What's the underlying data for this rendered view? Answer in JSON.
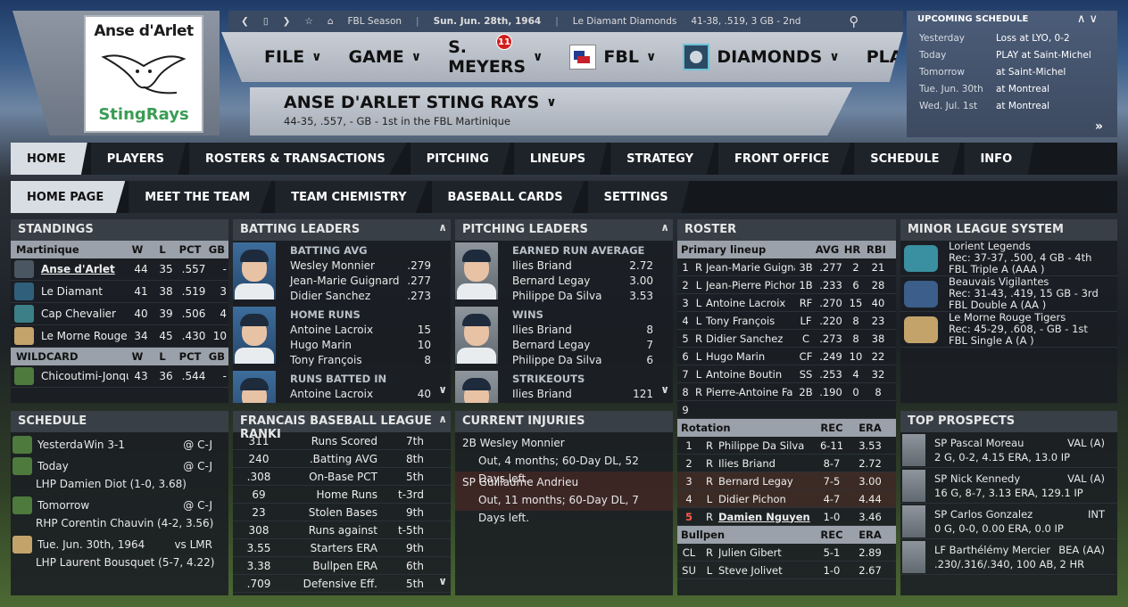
{
  "logo": {
    "line1": "Anse d'Arlet",
    "line2": "StingRays"
  },
  "topbar": {
    "season": "FBL Season",
    "date": "Sun. Jun. 28th, 1964",
    "team": "Le Diamant Diamonds",
    "record": "41-38, .519, 3 GB - 2nd"
  },
  "menu": {
    "file": "FILE",
    "game": "GAME",
    "manager": "S. MEYERS",
    "badge": "11",
    "league": "FBL",
    "team": "DIAMONDS",
    "play": "PLAY"
  },
  "team": {
    "name": "ANSE D'ARLET STING RAYS",
    "summary": "44-35, .557, - GB - 1st in the FBL Martinique"
  },
  "upcoming": {
    "title": "UPCOMING SCHEDULE",
    "rows": [
      {
        "day": "Yesterday",
        "event": "Loss at LYO, 0-2"
      },
      {
        "day": "Today",
        "event": "PLAY at Saint-Michel"
      },
      {
        "day": "Tomorrow",
        "event": "at Saint-Michel"
      },
      {
        "day": "Tue. Jun. 30th",
        "event": "at Montreal"
      },
      {
        "day": "Wed. Jul. 1st",
        "event": "at Montreal"
      }
    ]
  },
  "tabs1": [
    "HOME",
    "PLAYERS",
    "ROSTERS & TRANSACTIONS",
    "PITCHING",
    "LINEUPS",
    "STRATEGY",
    "FRONT OFFICE",
    "SCHEDULE",
    "INFO"
  ],
  "tabs2": [
    "HOME PAGE",
    "MEET THE TEAM",
    "TEAM CHEMISTRY",
    "BASEBALL CARDS",
    "SETTINGS"
  ],
  "standings": {
    "title": "STANDINGS",
    "div": "Martinique",
    "cols": [
      "W",
      "L",
      "PCT",
      "GB"
    ],
    "rows": [
      {
        "team": "Anse d'Arlet",
        "w": "44",
        "l": "35",
        "pct": ".557",
        "gb": "-",
        "color": "#4a5662"
      },
      {
        "team": "Le Diamant",
        "w": "41",
        "l": "38",
        "pct": ".519",
        "gb": "3",
        "color": "#2f5f7a"
      },
      {
        "team": "Cap Chevalier",
        "w": "40",
        "l": "39",
        "pct": ".506",
        "gb": "4",
        "color": "#3c7f86"
      },
      {
        "team": "Le Morne Rouge",
        "w": "34",
        "l": "45",
        "pct": ".430",
        "gb": "10",
        "color": "#c4a36a"
      }
    ],
    "wild": "WILDCARD",
    "wildrows": [
      {
        "team": "Chicoutimi-Jonqu",
        "w": "43",
        "l": "36",
        "pct": ".544",
        "gb": "-",
        "color": "#4e7a3e"
      }
    ]
  },
  "batting": {
    "title": "BATTING LEADERS",
    "groups": [
      {
        "label": "BATTING AVG",
        "rows": [
          [
            "Wesley Monnier",
            ".279"
          ],
          [
            "Jean-Marie Guignard",
            ".277"
          ],
          [
            "Didier Sanchez",
            ".273"
          ]
        ]
      },
      {
        "label": "HOME RUNS",
        "rows": [
          [
            "Antoine Lacroix",
            "15"
          ],
          [
            "Hugo Marin",
            "10"
          ],
          [
            "Tony François",
            "8"
          ]
        ]
      },
      {
        "label": "RUNS BATTED IN",
        "rows": [
          [
            "Antoine Lacroix",
            "40"
          ]
        ]
      }
    ]
  },
  "pitching": {
    "title": "PITCHING LEADERS",
    "groups": [
      {
        "label": "EARNED RUN AVERAGE",
        "rows": [
          [
            "Ilies Briand",
            "2.72"
          ],
          [
            "Bernard Legay",
            "3.00"
          ],
          [
            "Philippe Da Silva",
            "3.53"
          ]
        ]
      },
      {
        "label": "WINS",
        "rows": [
          [
            "Ilies Briand",
            "8"
          ],
          [
            "Bernard Legay",
            "7"
          ],
          [
            "Philippe Da Silva",
            "6"
          ]
        ]
      },
      {
        "label": "STRIKEOUTS",
        "rows": [
          [
            "Ilies Briand",
            "121"
          ]
        ]
      }
    ]
  },
  "roster": {
    "title": "ROSTER",
    "lineup_label": "Primary lineup",
    "cols": [
      "AVG",
      "HR",
      "RBI"
    ],
    "lineup": [
      [
        "1",
        "R",
        "Jean-Marie Guigna",
        "3B",
        ".277",
        "2",
        "21"
      ],
      [
        "2",
        "L",
        "Jean-Pierre Pichon",
        "1B",
        ".233",
        "6",
        "28"
      ],
      [
        "3",
        "L",
        "Antoine Lacroix",
        "RF",
        ".270",
        "15",
        "40"
      ],
      [
        "4",
        "L",
        "Tony François",
        "LF",
        ".220",
        "8",
        "23"
      ],
      [
        "5",
        "R",
        "Didier Sanchez",
        "C",
        ".273",
        "8",
        "38"
      ],
      [
        "6",
        "L",
        "Hugo Marin",
        "CF",
        ".249",
        "10",
        "22"
      ],
      [
        "7",
        "L",
        "Antoine Boutin",
        "SS",
        ".253",
        "4",
        "32"
      ],
      [
        "8",
        "R",
        "Pierre-Antoine Fa",
        "2B",
        ".190",
        "0",
        "8"
      ],
      [
        "9",
        "",
        "",
        "",
        "",
        "",
        ""
      ]
    ],
    "rotation_label": "Rotation",
    "rcols": [
      "REC",
      "ERA"
    ],
    "rotation": [
      [
        "1",
        "R",
        "Philippe Da Silva",
        "6-11",
        "3.53"
      ],
      [
        "2",
        "R",
        "Ilies Briand",
        "8-7",
        "2.72"
      ],
      [
        "3",
        "R",
        "Bernard Legay",
        "7-5",
        "3.00"
      ],
      [
        "4",
        "L",
        "Didier Pichon",
        "4-7",
        "4.44"
      ],
      [
        "5",
        "R",
        "Damien Nguyen",
        "1-0",
        "3.46"
      ]
    ],
    "bullpen_label": "Bullpen",
    "bullpen": [
      [
        "CL",
        "R",
        "Julien Gibert",
        "5-1",
        "2.89"
      ],
      [
        "SU",
        "L",
        "Steve Jolivet",
        "1-0",
        "2.67"
      ]
    ]
  },
  "minors": {
    "title": "MINOR LEAGUE SYSTEM",
    "rows": [
      {
        "name": "Lorient Legends",
        "rec": "Rec: 37-37, .500, 4 GB - 4th",
        "lvl": "FBL Triple A (AAA )",
        "color": "#3a8fa0"
      },
      {
        "name": "Beauvais Vigilantes",
        "rec": "Rec: 31-43, .419, 15 GB - 3rd",
        "lvl": "FBL Double A (AA )",
        "color": "#3b5e8a"
      },
      {
        "name": "Le Morne Rouge Tigers",
        "rec": "Rec: 45-29, .608, - GB - 1st",
        "lvl": "FBL Single A (A )",
        "color": "#c4a36a"
      }
    ]
  },
  "schedule": {
    "title": "SCHEDULE",
    "rows": [
      {
        "day": "Yesterday",
        "res": "Win 3-1",
        "opp": "@ C-J",
        "detail": ""
      },
      {
        "day": "Today",
        "res": "",
        "opp": "@ C-J",
        "detail": "LHP Damien Diot (1-0, 3.68)"
      },
      {
        "day": "Tomorrow",
        "res": "",
        "opp": "@ C-J",
        "detail": "RHP Corentin Chauvin (4-2, 3.56)"
      },
      {
        "day": "Tue. Jun. 30th, 1964",
        "res": "",
        "opp": "vs LMR",
        "detail": "LHP Laurent Bousquet (5-7, 4.22)"
      }
    ]
  },
  "rankings": {
    "title": "FRANCAIS BASEBALL LEAGUE RANKI",
    "rows": [
      [
        "311",
        "Runs Scored",
        "7th"
      ],
      [
        "240",
        ".Batting AVG",
        "8th"
      ],
      [
        ".308",
        "On-Base PCT",
        "5th"
      ],
      [
        "69",
        "Home Runs",
        "t-3rd"
      ],
      [
        "23",
        "Stolen Bases",
        "9th"
      ],
      [
        "308",
        "Runs against",
        "t-5th"
      ],
      [
        "3.55",
        "Starters ERA",
        "9th"
      ],
      [
        "3.38",
        "Bullpen ERA",
        "6th"
      ],
      [
        ".709",
        "Defensive Eff.",
        "5th"
      ]
    ]
  },
  "injuries": {
    "title": "CURRENT INJURIES",
    "rows": [
      {
        "name": "2B Wesley Monnier",
        "detail": "Out, 4 months; 60-Day DL, 52 Days left."
      },
      {
        "name": "SP Guillaume Andrieu",
        "detail": "Out, 11 months; 60-Day DL, 7 Days left."
      }
    ]
  },
  "prospects": {
    "title": "TOP PROSPECTS",
    "rows": [
      {
        "name": "SP Pascal Moreau",
        "team": "VAL (A)",
        "line": "2 G, 0-2, 4.15 ERA, 13.0 IP"
      },
      {
        "name": "SP Nick Kennedy",
        "team": "VAL (A)",
        "line": "16 G, 8-7, 3.13 ERA, 129.1 IP"
      },
      {
        "name": "SP Carlos Gonzalez",
        "team": "INT",
        "line": "0 G, 0-0, 0.00 ERA, 0.0 IP"
      },
      {
        "name": "LF Barthélémy Mercier",
        "team": "BEA (AA)",
        "line": ".230/.316/.340, 100 AB, 2 HR"
      }
    ]
  }
}
